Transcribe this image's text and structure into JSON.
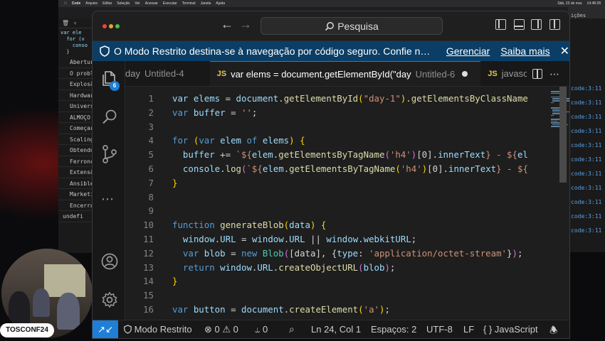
{
  "menubar": {
    "items": [
      "Code",
      "Arquivo",
      "Editar",
      "Seleção",
      "Ver",
      "Acessar",
      "Executar",
      "Terminal",
      "Janela",
      "Ajuda"
    ],
    "date": "Sáb, 23 de mar.",
    "time": "14:48:28"
  },
  "background_panel": {
    "items": [
      "Abertur",
      "O probl",
      "Explosã",
      "Hardwar",
      "Univers",
      "ALMOÇO",
      "Começar",
      "Scaling",
      "Obtendo",
      "Ferronc",
      "Extensã",
      "Ansible",
      "Marketi",
      "Encerra"
    ],
    "footer": "undefi",
    "code": "var ele\n  for (v\n    conso\n  }",
    "right_header": "ições",
    "right_link": "code:3:11"
  },
  "window": {
    "search_placeholder": "Pesquisa",
    "banner": {
      "message": "O Modo Restrito destina-se à navegação por código seguro. Confie nesta jane...",
      "manage": "Gerenciar",
      "learn_more": "Saiba mais"
    },
    "badge": "6",
    "tabs": [
      {
        "name": "day",
        "desc": "Untitled-4",
        "dirty": false,
        "active": false,
        "js": false
      },
      {
        "name": "var elems = document.getElementById(\"day",
        "desc": "Untitled-6",
        "dirty": true,
        "active": true,
        "js": true
      },
      {
        "name": "javasc",
        "desc": "",
        "dirty": false,
        "active": false,
        "js": true
      }
    ],
    "js_label": "JS",
    "code_lines": [
      {
        "n": "1",
        "t": [
          [
            "id",
            "var "
          ],
          [
            "id",
            "elems"
          ],
          [
            "d",
            " = "
          ],
          [
            "id",
            "document"
          ],
          [
            "d",
            "."
          ],
          [
            "fn",
            "getElementById"
          ],
          [
            "yb",
            "("
          ],
          [
            "st",
            "\"day-1\""
          ],
          [
            "yb",
            ")"
          ],
          [
            "d",
            "."
          ],
          [
            "fn",
            "getElementsByClassName"
          ]
        ]
      },
      {
        "n": "2",
        "t": [
          [
            "kw",
            "var "
          ],
          [
            "id",
            "buffer"
          ],
          [
            "d",
            " = "
          ],
          [
            "st",
            "''"
          ],
          [
            "d",
            ";"
          ]
        ]
      },
      {
        "n": "3",
        "t": []
      },
      {
        "n": "4",
        "t": [
          [
            "kw",
            "for "
          ],
          [
            "yb",
            "("
          ],
          [
            "kw",
            "var "
          ],
          [
            "id",
            "elem"
          ],
          [
            "kw",
            " of "
          ],
          [
            "id",
            "elems"
          ],
          [
            "yb",
            ")"
          ],
          [
            "d",
            " "
          ],
          [
            "yb",
            "{"
          ]
        ]
      },
      {
        "n": "5",
        "t": [
          [
            "d",
            "  "
          ],
          [
            "id",
            "buffer"
          ],
          [
            "d",
            " += "
          ],
          [
            "st",
            "`${"
          ],
          [
            "id",
            "elem"
          ],
          [
            "d",
            "."
          ],
          [
            "fn",
            "getElementsByTagName"
          ],
          [
            "pb",
            "("
          ],
          [
            "st",
            "'h4'"
          ],
          [
            "pb",
            ")"
          ],
          [
            "d",
            "[0]."
          ],
          [
            "id",
            "innerText"
          ],
          [
            "st",
            "} - ${"
          ],
          [
            "id",
            "el"
          ]
        ]
      },
      {
        "n": "6",
        "t": [
          [
            "d",
            "  "
          ],
          [
            "id",
            "console"
          ],
          [
            "d",
            "."
          ],
          [
            "fn",
            "log"
          ],
          [
            "pb",
            "("
          ],
          [
            "st",
            "`${"
          ],
          [
            "id",
            "elem"
          ],
          [
            "d",
            "."
          ],
          [
            "fn",
            "getElementsByTagName"
          ],
          [
            "yb",
            "("
          ],
          [
            "st",
            "'h4'"
          ],
          [
            "yb",
            ")"
          ],
          [
            "d",
            "[0]."
          ],
          [
            "id",
            "innerText"
          ],
          [
            "st",
            "} - ${"
          ]
        ]
      },
      {
        "n": "7",
        "t": [
          [
            "yb",
            "}"
          ]
        ]
      },
      {
        "n": "8",
        "t": []
      },
      {
        "n": "9",
        "t": []
      },
      {
        "n": "10",
        "t": [
          [
            "kw",
            "function "
          ],
          [
            "fn",
            "generateBlob"
          ],
          [
            "yb",
            "("
          ],
          [
            "id",
            "data"
          ],
          [
            "yb",
            ")"
          ],
          [
            "d",
            " "
          ],
          [
            "yb",
            "{"
          ]
        ]
      },
      {
        "n": "11",
        "t": [
          [
            "d",
            "  "
          ],
          [
            "id",
            "window"
          ],
          [
            "d",
            "."
          ],
          [
            "id",
            "URL"
          ],
          [
            "d",
            " = "
          ],
          [
            "id",
            "window"
          ],
          [
            "d",
            "."
          ],
          [
            "id",
            "URL"
          ],
          [
            "d",
            " || "
          ],
          [
            "id",
            "window"
          ],
          [
            "d",
            "."
          ],
          [
            "id",
            "webkitURL"
          ],
          [
            "d",
            ";"
          ]
        ]
      },
      {
        "n": "12",
        "t": [
          [
            "d",
            "  "
          ],
          [
            "kw",
            "var "
          ],
          [
            "id",
            "blob"
          ],
          [
            "d",
            " = "
          ],
          [
            "kw",
            "new "
          ],
          [
            "cl",
            "Blob"
          ],
          [
            "pb",
            "("
          ],
          [
            "d",
            "[data], {"
          ],
          [
            "id",
            "type"
          ],
          [
            "d",
            ": "
          ],
          [
            "st",
            "'application/octet-stream'"
          ],
          [
            "d",
            "}"
          ],
          [
            "pb",
            ")"
          ],
          [
            "d",
            ";"
          ]
        ]
      },
      {
        "n": "13",
        "t": [
          [
            "d",
            "  "
          ],
          [
            "kw",
            "return "
          ],
          [
            "id",
            "window"
          ],
          [
            "d",
            "."
          ],
          [
            "id",
            "URL"
          ],
          [
            "d",
            "."
          ],
          [
            "fn",
            "createObjectURL"
          ],
          [
            "pb",
            "("
          ],
          [
            "id",
            "blob"
          ],
          [
            "pb",
            ")"
          ],
          [
            "d",
            ";"
          ]
        ]
      },
      {
        "n": "14",
        "t": [
          [
            "yb",
            "}"
          ]
        ]
      },
      {
        "n": "15",
        "t": []
      },
      {
        "n": "16",
        "t": [
          [
            "kw",
            "var "
          ],
          [
            "id",
            "button"
          ],
          [
            "d",
            " = "
          ],
          [
            "id",
            "document"
          ],
          [
            "d",
            "."
          ],
          [
            "fn",
            "createElement"
          ],
          [
            "yb",
            "("
          ],
          [
            "st",
            "'a'"
          ],
          [
            "yb",
            ")"
          ],
          [
            "d",
            ";"
          ]
        ]
      }
    ],
    "status": {
      "restricted": "Modo Restrito",
      "errors": "0",
      "warnings": "0",
      "ports": "0",
      "position": "Ln 24, Col 1",
      "spaces": "Espaços: 2",
      "encoding": "UTF-8",
      "eol": "LF",
      "language": "JavaScript",
      "language_icon": "{ }"
    }
  },
  "camera": {
    "label": "TOSCONF24"
  }
}
